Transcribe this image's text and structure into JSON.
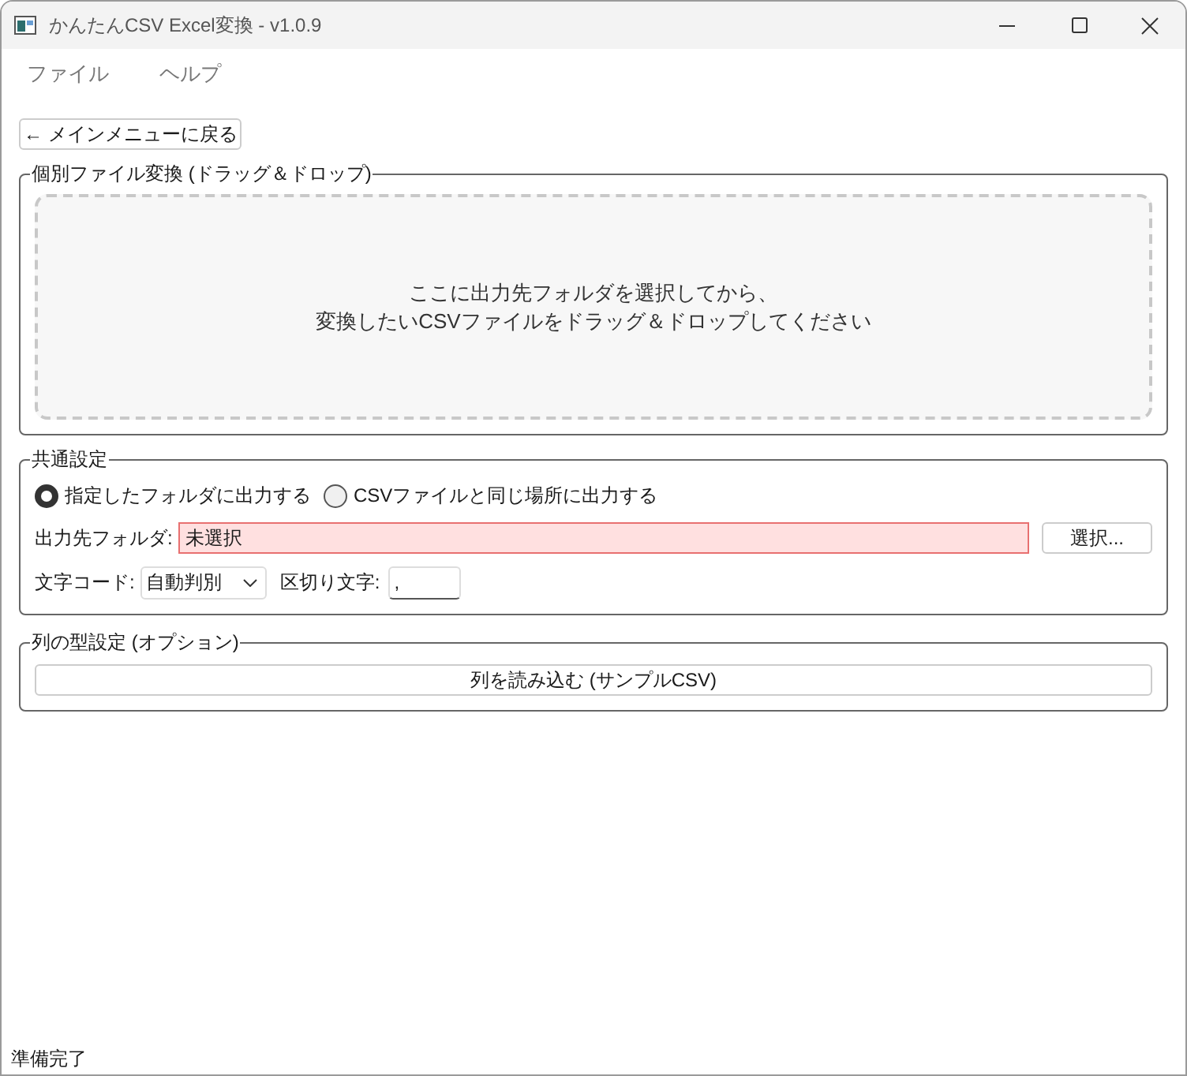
{
  "window": {
    "title": "かんたんCSV Excel変換 - v1.0.9"
  },
  "menu": [
    "ファイル",
    "ヘルプ"
  ],
  "back_button": "← メインメニューに戻る",
  "drop_group": {
    "title": "個別ファイル変換 (ドラッグ＆ドロップ)",
    "message_lines": [
      "ここに出力先フォルダを選択してから、",
      "変換したいCSVファイルをドラッグ＆ドロップしてください"
    ]
  },
  "common_settings": {
    "title": "共通設定",
    "output_options": [
      {
        "label": "指定したフォルダに出力する",
        "selected": true
      },
      {
        "label": "CSVファイルと同じ場所に出力する",
        "selected": false
      }
    ],
    "output_folder": {
      "label": "出力先フォルダ:",
      "value": "未選択",
      "invalid": true
    },
    "select_button": "選択...",
    "encoding": {
      "label": "文字コード:",
      "value": "自動判別"
    },
    "delimiter": {
      "label": "区切り文字:",
      "value": ","
    }
  },
  "column_types": {
    "title": "列の型設定 (オプション)",
    "load_button": "列を読み込む (サンプルCSV)"
  },
  "status_bar": "準備完了"
}
